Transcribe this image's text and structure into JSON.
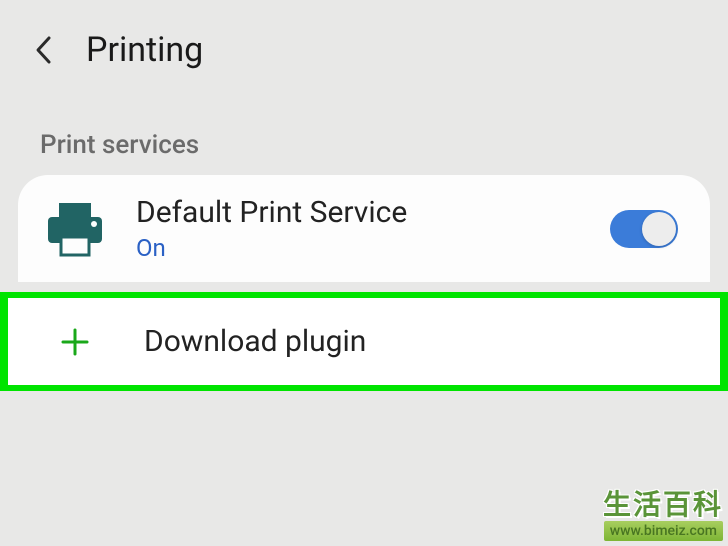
{
  "header": {
    "title": "Printing"
  },
  "section": {
    "label": "Print services"
  },
  "service": {
    "name": "Default Print Service",
    "status": "On",
    "toggle_on": true
  },
  "download": {
    "label": "Download plugin"
  },
  "watermark": {
    "cn": "生活百科",
    "url": "www.bimeiz.com"
  }
}
